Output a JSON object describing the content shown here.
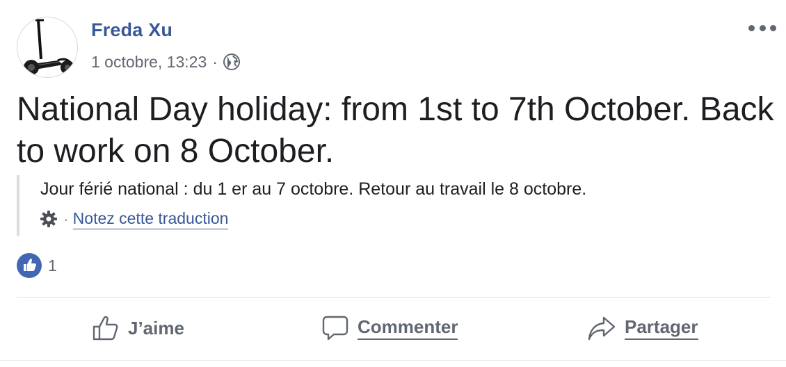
{
  "post": {
    "author": "Freda Xu",
    "timestamp": "1 octobre, 13:23",
    "separator": "·",
    "audience_icon": "globe-icon",
    "text": "National Day holiday: from 1st to 7th October. Back to work on 8 October.",
    "translation": {
      "text": "Jour férié national : du 1 er au 7 octobre. Retour au travail le 8 octobre.",
      "settings_icon": "gear-icon",
      "separator": "·",
      "rate_label": "Notez cette traduction"
    },
    "reactions": {
      "icon": "like-icon",
      "count": "1",
      "color": "#4267b2"
    }
  },
  "actions": {
    "like": {
      "label": "J’aime",
      "icon": "thumbs-up-icon"
    },
    "comment": {
      "label": "Commenter",
      "icon": "comment-icon"
    },
    "share": {
      "label": "Partager",
      "icon": "share-icon"
    }
  },
  "colors": {
    "author": "#385898",
    "meta": "#616770",
    "text": "#1c1e21",
    "action": "#606770",
    "divider": "#dadde1"
  }
}
